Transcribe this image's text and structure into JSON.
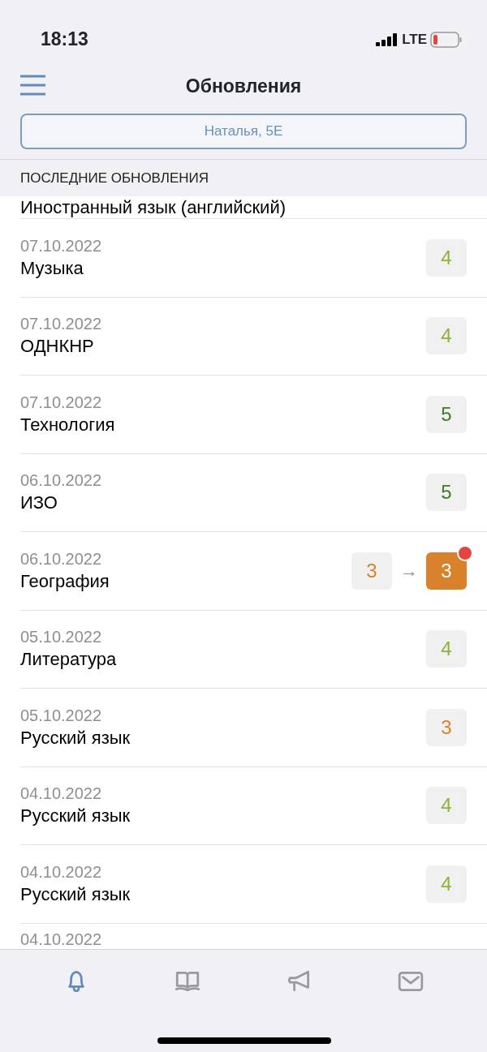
{
  "status_bar": {
    "time": "18:13",
    "network": "LTE"
  },
  "nav": {
    "title": "Обновления"
  },
  "student_selector": {
    "value": "Наталья, 5Е"
  },
  "section": {
    "title": "ПОСЛЕДНИЕ ОБНОВЛЕНИЯ"
  },
  "updates": [
    {
      "subject": "Иностранный язык (английский)"
    },
    {
      "date": "07.10.2022",
      "subject": "Музыка",
      "grade": {
        "value": "4",
        "color": "#8db33a"
      }
    },
    {
      "date": "07.10.2022",
      "subject": "ОДНКНР",
      "grade": {
        "value": "4",
        "color": "#8db33a"
      }
    },
    {
      "date": "07.10.2022",
      "subject": "Технология",
      "grade": {
        "value": "5",
        "color": "#3f7a2a"
      }
    },
    {
      "date": "06.10.2022",
      "subject": "ИЗО",
      "grade": {
        "value": "5",
        "color": "#3f7a2a"
      }
    },
    {
      "date": "06.10.2022",
      "subject": "География",
      "previous": {
        "value": "3",
        "color": "#d9822b"
      },
      "arrow": "→",
      "grade": {
        "value": "3",
        "color": "#d9822b",
        "new": true
      }
    },
    {
      "date": "05.10.2022",
      "subject": "Литература",
      "grade": {
        "value": "4",
        "color": "#8db33a"
      }
    },
    {
      "date": "05.10.2022",
      "subject": "Русский язык",
      "grade": {
        "value": "3",
        "color": "#d9822b"
      }
    },
    {
      "date": "04.10.2022",
      "subject": "Русский язык",
      "grade": {
        "value": "4",
        "color": "#8db33a"
      }
    },
    {
      "date": "04.10.2022",
      "subject": "Русский язык",
      "grade": {
        "value": "4",
        "color": "#8db33a"
      }
    },
    {
      "date": "04.10.2022"
    }
  ],
  "tab_bar": [
    {
      "kind": "bell",
      "selected": true
    },
    {
      "kind": "book",
      "selected": false
    },
    {
      "kind": "megaphone",
      "selected": false
    },
    {
      "kind": "mail",
      "selected": false
    }
  ]
}
